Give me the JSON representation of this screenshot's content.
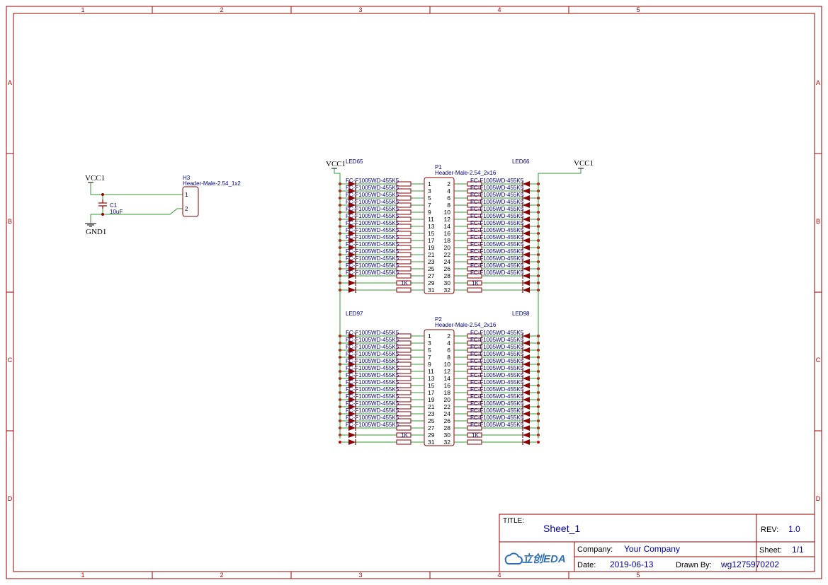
{
  "frame": {
    "col_labels": [
      "1",
      "2",
      "3",
      "4",
      "5"
    ],
    "row_labels": [
      "A",
      "B",
      "C",
      "D"
    ]
  },
  "colors": {
    "border": "#990000",
    "wire": "#339933",
    "symbol": "#880000",
    "label": "#000080",
    "pin_text": "#000000"
  },
  "power": {
    "vcc_left": "VCC1",
    "vcc_p1_left": "VCC1",
    "vcc_p1_right": "VCC1",
    "gnd": "GND1"
  },
  "header_h3": {
    "designator": "H3",
    "value": "Header-Male-2.54_1x2",
    "pins": [
      "1",
      "2"
    ]
  },
  "capacitor": {
    "designator": "C1",
    "value": "10uF"
  },
  "p1": {
    "designator": "P1",
    "value": "Header-Male-2.54_2x16",
    "left_pins": [
      "1",
      "3",
      "5",
      "7",
      "9",
      "11",
      "13",
      "15",
      "17",
      "19",
      "21",
      "23",
      "25",
      "27",
      "29",
      "31"
    ],
    "right_pins": [
      "2",
      "4",
      "6",
      "8",
      "10",
      "12",
      "14",
      "16",
      "18",
      "20",
      "22",
      "24",
      "26",
      "28",
      "30",
      "32"
    ],
    "led_left_top": "LED65",
    "led_right_top": "LED66",
    "res_label": "1K"
  },
  "p2": {
    "designator": "P2",
    "value": "Header-Male-2.54_2x16",
    "left_pins": [
      "1",
      "3",
      "5",
      "7",
      "9",
      "11",
      "13",
      "15",
      "17",
      "19",
      "21",
      "23",
      "25",
      "27",
      "29",
      "31"
    ],
    "right_pins": [
      "2",
      "4",
      "6",
      "8",
      "10",
      "12",
      "14",
      "16",
      "18",
      "20",
      "22",
      "24",
      "26",
      "28",
      "30",
      "32"
    ],
    "led_left_top": "LED97",
    "led_right_top": "LED98",
    "res_label": "1K"
  },
  "part_text": {
    "led_left": "FC-F1005WD-455K5",
    "led_right": "FC-F1005WD-455K5"
  },
  "title_block": {
    "title_label": "TITLE:",
    "title": "Sheet_1",
    "rev_label": "REV:",
    "rev": "1.0",
    "company_label": "Company:",
    "company": "Your Company",
    "sheet_label": "Sheet:",
    "sheet": "1/1",
    "date_label": "Date:",
    "date": "2019-06-13",
    "drawn_label": "Drawn By:",
    "drawn_by": "wg1275970202",
    "logo_text": "立创EDA"
  }
}
